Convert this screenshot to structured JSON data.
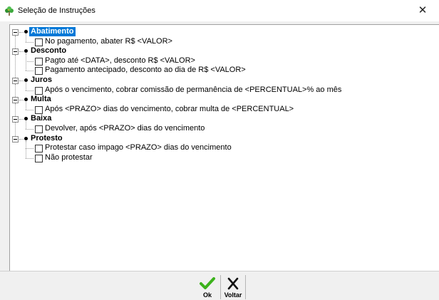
{
  "window": {
    "title": "Seleção de Instruções",
    "close_glyph": "✕",
    "app_icon": "plant-icon"
  },
  "tree": {
    "categories": [
      {
        "label": "Abatimento",
        "selected": true,
        "items": [
          "No pagamento, abater R$ <VALOR>"
        ]
      },
      {
        "label": "Desconto",
        "selected": false,
        "items": [
          "Pagto até <DATA>, desconto R$ <VALOR>",
          "Pagamento antecipado, desconto ao dia de R$ <VALOR>"
        ]
      },
      {
        "label": "Juros",
        "selected": false,
        "items": [
          "Após o vencimento, cobrar comissão de permanência de <PERCENTUAL>% ao mês"
        ]
      },
      {
        "label": "Multa",
        "selected": false,
        "items": [
          "Após <PRAZO> dias do vencimento, cobrar multa de <PERCENTUAL>"
        ]
      },
      {
        "label": "Baixa",
        "selected": false,
        "items": [
          "Devolver, após <PRAZO> dias do vencimento"
        ]
      },
      {
        "label": "Protesto",
        "selected": false,
        "items": [
          "Protestar caso impago <PRAZO> dias do vencimento",
          "Não protestar"
        ]
      }
    ]
  },
  "buttons": {
    "ok": {
      "label": "Ok",
      "icon": "check-icon",
      "color": "#3cb21c"
    },
    "back": {
      "label": "Voltar",
      "icon": "x-icon",
      "color": "#111111"
    }
  }
}
